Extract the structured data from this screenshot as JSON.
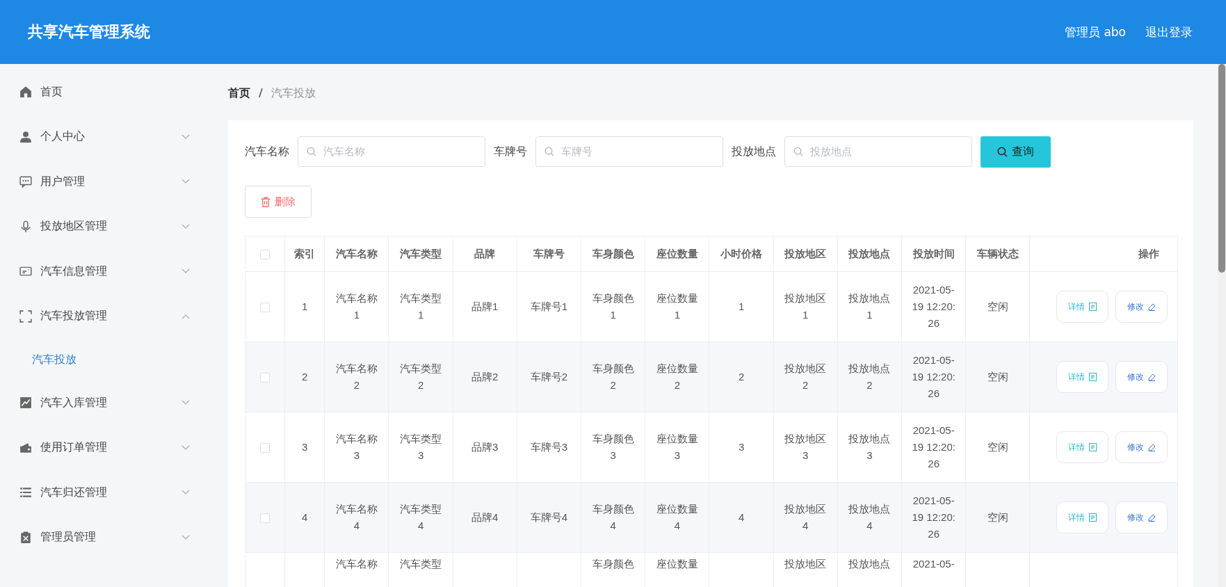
{
  "header": {
    "title": "共享汽车管理系统",
    "user": "管理员 abo",
    "logout": "退出登录"
  },
  "sidebar": {
    "items": [
      {
        "label": "首页",
        "selected": false
      },
      {
        "label": "个人中心",
        "expanded": false,
        "selected": false
      },
      {
        "label": "用户管理",
        "expanded": false,
        "selected": false
      },
      {
        "label": "投放地区管理",
        "expanded": false,
        "selected": false
      },
      {
        "label": "汽车信息管理",
        "expanded": false,
        "selected": false
      },
      {
        "label": "汽车投放管理",
        "expanded": true,
        "selected": false,
        "children": [
          {
            "label": "汽车投放",
            "selected": true
          }
        ]
      },
      {
        "label": "汽车入库管理",
        "expanded": false,
        "selected": false
      },
      {
        "label": "使用订单管理",
        "expanded": false,
        "selected": false
      },
      {
        "label": "汽车归还管理",
        "expanded": false,
        "selected": false
      },
      {
        "label": "管理员管理",
        "expanded": false,
        "selected": false
      }
    ]
  },
  "breadcrumb": [
    "首页",
    "/",
    "汽车投放"
  ],
  "search": {
    "fields": [
      {
        "label": "汽车名称",
        "placeholder": "汽车名称"
      },
      {
        "label": "车牌号",
        "placeholder": "车牌号"
      },
      {
        "label": "投放地点",
        "placeholder": "投放地点"
      }
    ],
    "button": "查询"
  },
  "delete_button": "删除",
  "table": {
    "select_all": {
      "checked": false
    },
    "columns": [
      "索引",
      "汽车名称",
      "汽车类型",
      "品牌",
      "车牌号",
      "车身颜色",
      "座位数量",
      "小时价格",
      "投放地区",
      "投放地点",
      "投放时间",
      "车辆状态",
      "操作"
    ],
    "rows": [
      {
        "checked": false,
        "cells": [
          "1",
          "汽车名称1",
          "汽车类型1",
          "品牌1",
          "车牌号1",
          "车身颜色1",
          "座位数量1",
          "1",
          "投放地区1",
          "投放地点1",
          "2021-05-19 12:20:26",
          "空闲"
        ],
        "actions": [
          {
            "kind": "detail",
            "label": "详情"
          },
          {
            "kind": "edit",
            "label": "修改"
          }
        ]
      },
      {
        "checked": false,
        "cells": [
          "2",
          "汽车名称2",
          "汽车类型2",
          "品牌2",
          "车牌号2",
          "车身颜色2",
          "座位数量2",
          "2",
          "投放地区2",
          "投放地点2",
          "2021-05-19 12:20:26",
          "空闲"
        ],
        "actions": [
          {
            "kind": "detail",
            "label": "详情"
          },
          {
            "kind": "edit",
            "label": "修改"
          }
        ]
      },
      {
        "checked": false,
        "cells": [
          "3",
          "汽车名称3",
          "汽车类型3",
          "品牌3",
          "车牌号3",
          "车身颜色3",
          "座位数量3",
          "3",
          "投放地区3",
          "投放地点3",
          "2021-05-19 12:20:26",
          "空闲"
        ],
        "actions": [
          {
            "kind": "detail",
            "label": "详情"
          },
          {
            "kind": "edit",
            "label": "修改"
          }
        ]
      },
      {
        "checked": false,
        "cells": [
          "4",
          "汽车名称4",
          "汽车类型4",
          "品牌4",
          "车牌号4",
          "车身颜色4",
          "座位数量4",
          "4",
          "投放地区4",
          "投放地点4",
          "2021-05-19 12:20:26",
          "空闲"
        ],
        "actions": [
          {
            "kind": "detail",
            "label": "详情"
          },
          {
            "kind": "edit",
            "label": "修改"
          }
        ]
      },
      {
        "cells": [
          null,
          "汽车名称",
          "汽车类型",
          null,
          null,
          "车身颜色",
          "座位数量",
          null,
          "投放地区",
          "投放地点",
          "2021-05-",
          null
        ]
      }
    ]
  }
}
